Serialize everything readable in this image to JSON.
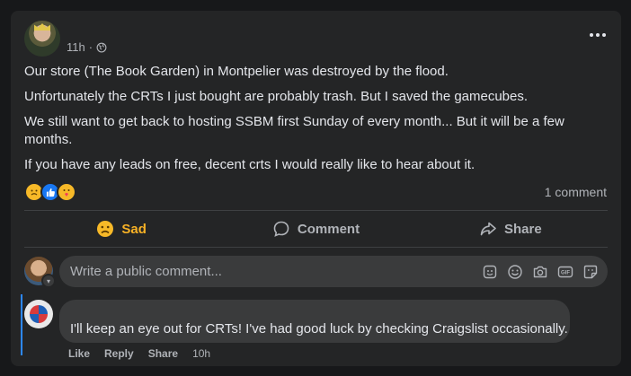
{
  "post": {
    "time": "11h",
    "paragraphs": [
      "Our store (The Book Garden) in Montpelier was destroyed by the flood.",
      "Unfortunately the CRTs I just bought are probably trash. But I saved the gamecubes.",
      "We still want to get back to hosting SSBM first Sunday of every month... But it will be a few months.",
      "If you have any leads on free, decent crts I would really like to hear about it."
    ],
    "comment_count": "1 comment"
  },
  "actions": {
    "sad_label": "Sad",
    "comment_label": "Comment",
    "share_label": "Share"
  },
  "composer": {
    "placeholder": "Write a public comment..."
  },
  "comment": {
    "author": "",
    "text": "I'll keep an eye out for CRTs! I've had good luck by checking Craigslist occasionally.",
    "like": "Like",
    "reply": "Reply",
    "share": "Share",
    "time": "10h"
  },
  "colors": {
    "card_bg": "#242526",
    "sad_accent": "#f7b125",
    "thread_line": "#2d88ff"
  }
}
